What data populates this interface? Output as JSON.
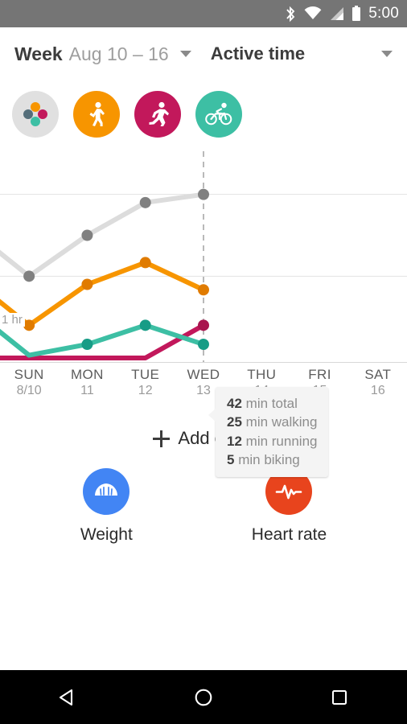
{
  "statusbar": {
    "time": "5:00",
    "icons": [
      "bluetooth-icon",
      "wifi-icon",
      "cell-signal-icon",
      "battery-icon"
    ]
  },
  "header": {
    "range_prefix": "Week",
    "range_dates": "Aug 10 – 16",
    "range_caret": "chevron-down-icon",
    "metric": "Active time",
    "metric_caret": "chevron-down-icon"
  },
  "activity_chips": [
    {
      "name": "all-activities",
      "label": "All activities",
      "bg": "#e0e0e0",
      "icon": "four-dots-icon",
      "selected": true
    },
    {
      "name": "walking",
      "label": "Walking",
      "bg": "#f79500",
      "icon": "walking-icon",
      "selected": false
    },
    {
      "name": "running",
      "label": "Running",
      "bg": "#c2185b",
      "icon": "running-icon",
      "selected": false
    },
    {
      "name": "biking",
      "label": "Biking",
      "bg": "#3dbfa4",
      "icon": "biking-icon",
      "selected": false
    }
  ],
  "chart_data": {
    "type": "line",
    "title": "Active time",
    "xlabel": "",
    "ylabel": "Active time",
    "grid": true,
    "legend_position": "chips-above",
    "categories": [
      "SUN",
      "MON",
      "TUE",
      "WED",
      "THU",
      "FRI",
      "SAT"
    ],
    "category_sublabels": [
      "8/10",
      "11",
      "12",
      "13",
      "14",
      "15",
      "16"
    ],
    "ytick_labels": [
      "1 hr"
    ],
    "ytick_values": [
      60
    ],
    "ylim": [
      0,
      72
    ],
    "yunit": "min",
    "gridline_values": [
      60,
      30
    ],
    "highlight_day": "WED",
    "highlight_index": 3,
    "series": [
      {
        "name": "Total",
        "color": "#dcdcdc",
        "dot": "#808080",
        "values": [
          30,
          45,
          57,
          60,
          null,
          null,
          null
        ]
      },
      {
        "name": "Walking",
        "color": "#f79500",
        "dot": "#e07b00",
        "values": [
          12,
          27,
          35,
          25,
          null,
          null,
          null
        ]
      },
      {
        "name": "Running",
        "color": "#c2185b",
        "dot": "#a8144e",
        "values": [
          0,
          0,
          0,
          12,
          null,
          null,
          null
        ]
      },
      {
        "name": "Biking",
        "color": "#3dbfa4",
        "dot": "#179c86",
        "values": [
          1,
          5,
          12,
          5,
          null,
          null,
          null
        ]
      }
    ]
  },
  "tooltip": {
    "rows": [
      {
        "value": "42",
        "label": "min total"
      },
      {
        "value": "25",
        "label": "min walking"
      },
      {
        "value": "12",
        "label": "min running"
      },
      {
        "value": "5",
        "label": "min biking"
      }
    ]
  },
  "add_chart": {
    "plus_icon": "plus-icon",
    "label": "Add chart"
  },
  "suggestions": [
    {
      "name": "weight",
      "label": "Weight",
      "bg": "#4285f4",
      "icon": "scale-icon"
    },
    {
      "name": "heart-rate",
      "label": "Heart rate",
      "bg": "#e8441d",
      "icon": "heart-pulse-icon"
    }
  ],
  "navbar": {
    "back": "back-triangle-icon",
    "home": "home-circle-icon",
    "recents": "recents-square-icon"
  }
}
